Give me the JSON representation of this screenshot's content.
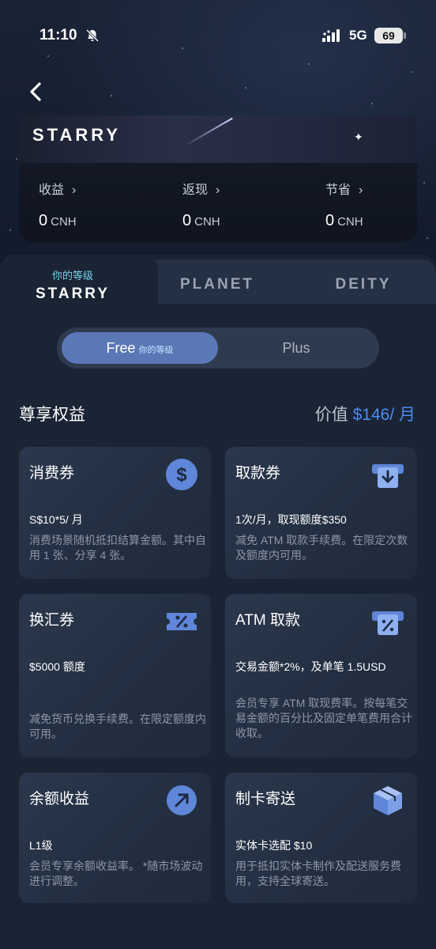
{
  "status_bar": {
    "time": "11:10",
    "network": "5G",
    "battery": "69"
  },
  "top_card": {
    "brand": "STARRY",
    "stats": [
      {
        "label": "收益",
        "value": "0",
        "unit": "CNH"
      },
      {
        "label": "返现",
        "value": "0",
        "unit": "CNH"
      },
      {
        "label": "节省",
        "value": "0",
        "unit": "CNH"
      }
    ]
  },
  "tiers": {
    "current_label": "你的等级",
    "items": [
      "STARRY",
      "PLANET",
      "DEITY"
    ]
  },
  "plan_toggle": {
    "free_label": "Free",
    "free_badge": "你的等级",
    "plus_label": "Plus"
  },
  "benefits_header": {
    "title": "尊享权益",
    "value_label": "价值",
    "value_amount": "$146/ 月"
  },
  "benefits": [
    {
      "title": "消费券",
      "icon": "dollar-coin-icon",
      "main": "S$10*5/ 月",
      "desc": "消费场景随机抵扣结算金额。其中自用 1 张、分享 4 张。"
    },
    {
      "title": "取款券",
      "icon": "atm-withdraw-icon",
      "main": "1次/月，取现额度$350",
      "desc": "减免 ATM 取款手续费。在限定次数及额度内可用。"
    },
    {
      "title": "换汇券",
      "icon": "exchange-ticket-icon",
      "main": "$5000 额度",
      "desc": "减免货币兑换手续费。在限定额度内可用。"
    },
    {
      "title": "ATM 取款",
      "icon": "atm-percent-icon",
      "main": "交易金额*2%，及单笔 1.5USD",
      "desc": "会员专享 ATM 取现费率。按每笔交易金额的百分比及固定单笔费用合计收取。"
    },
    {
      "title": "余额收益",
      "icon": "arrow-up-right-icon",
      "main": "L1级",
      "desc": "会员专享余额收益率。 *随市场波动进行调整。"
    },
    {
      "title": "制卡寄送",
      "icon": "package-box-icon",
      "main": "实体卡选配 $10",
      "desc": "用于抵扣实体卡制作及配送服务费用，支持全球寄送。"
    }
  ]
}
